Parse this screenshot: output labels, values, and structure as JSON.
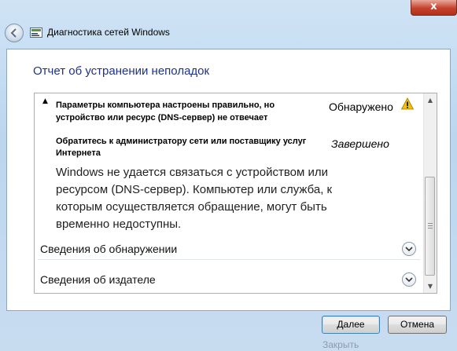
{
  "titlebar": {
    "close_label": "x"
  },
  "window": {
    "title": "Диагностика сетей Windows"
  },
  "heading": "Отчет об устранении неполадок",
  "issue": {
    "title": "Параметры компьютера настроены правильно, но устройство или ресурс (DNS-сервер) не отвечает",
    "status": "Обнаружено",
    "status_icon": "warning-icon",
    "action": "Обратитесь к администратору сети или поставщику услуг Интернета",
    "action_status": "Завершено",
    "description": "Windows не удается связаться с устройством или ресурсом (DNS-сервер). Компьютер или служба, к которым осуществляется обращение, могут быть временно недоступны."
  },
  "sections": [
    {
      "label": "Сведения об обнаружении"
    },
    {
      "label": "Сведения об издателе"
    }
  ],
  "buttons": {
    "next": "Далее",
    "cancel": "Отмена"
  },
  "ghost_text": "Закрыть",
  "colors": {
    "heading": "#1e3287",
    "warning": "#f2c200"
  }
}
